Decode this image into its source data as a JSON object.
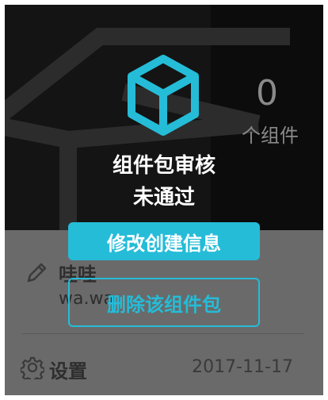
{
  "component_package": {
    "count": "0",
    "count_label": "个组件",
    "owner_name": "哇哇",
    "owner_id": "wa.wa",
    "settings_label": "设置",
    "date": "2017-11-17"
  },
  "overlay": {
    "title": "组件包审核",
    "status": "未通过",
    "primary_button": "修改创建信息",
    "secondary_button": "删除该组件包"
  },
  "icons": {
    "status": "cube-icon",
    "owner": "pencil-icon",
    "settings": "gear-icon"
  },
  "colors": {
    "accent": "#25bcd8",
    "banner": "#141414",
    "overlay_text": "#ffffff"
  }
}
